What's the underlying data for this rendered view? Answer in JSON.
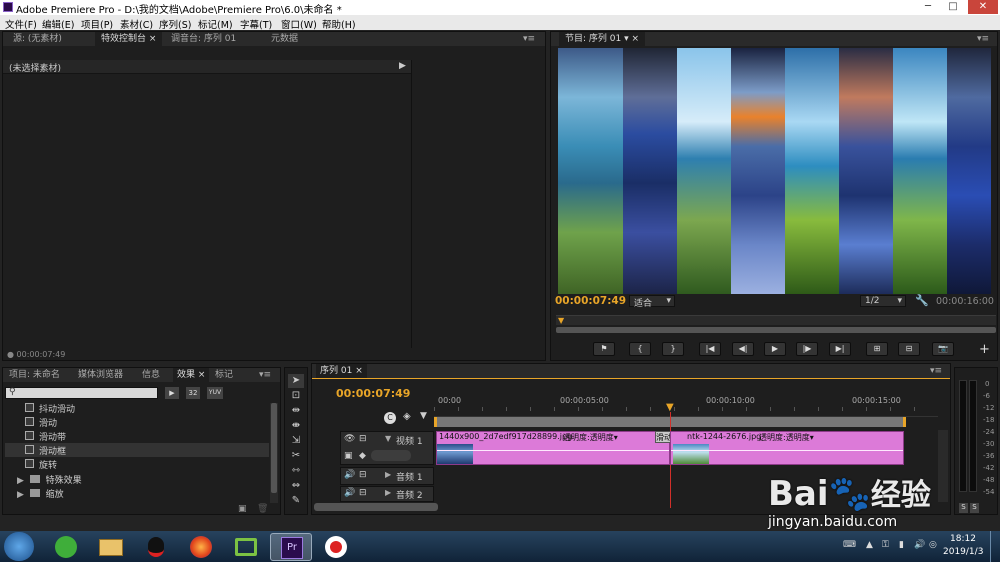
{
  "window": {
    "title": "Adobe Premiere Pro - D:\\我的文档\\Adobe\\Premiere Pro\\6.0\\未命名 *",
    "min": "─",
    "max": "□",
    "close": "✕"
  },
  "menu": [
    "文件(F)",
    "编辑(E)",
    "项目(P)",
    "素材(C)",
    "序列(S)",
    "标记(M)",
    "字幕(T)",
    "窗口(W)",
    "帮助(H)"
  ],
  "source_panel": {
    "tabs": [
      "源: (无素材)",
      "特效控制台",
      "调音台: 序列 01",
      "元数据"
    ],
    "no_clip": "(未选择素材)",
    "timecode": "00:00:07:49"
  },
  "program_panel": {
    "tab": "节目: 序列 01",
    "timecode": "00:00:07:49",
    "fit": "适合",
    "resolution": "1/2",
    "duration": "00:00:16:00",
    "buttons": [
      "⚑",
      "{",
      "}",
      "|◀",
      "◀|",
      "▶",
      "|▶",
      "▶|",
      "⊞",
      "⊟",
      "📷"
    ],
    "add": "+"
  },
  "project_panel": {
    "tabs": [
      "项目: 未命名",
      "媒体浏览器",
      "信息",
      "效果",
      "标记"
    ],
    "badges": [
      "▶",
      "32",
      "YUV"
    ],
    "effects": [
      "抖动滑动",
      "滑动",
      "滑动带",
      "滑动框",
      "旋转"
    ],
    "folders": [
      "特殊效果",
      "缩放"
    ]
  },
  "timeline": {
    "tab": "序列 01",
    "timecode": "00:00:07:49",
    "ruler": [
      "00:00",
      "00:00:05:00",
      "00:00:10:00",
      "00:00:15:00"
    ],
    "tracks": {
      "video1": "视频 1",
      "audio1": "音频 1",
      "audio2": "音频 2"
    },
    "clip1": {
      "name": "1440x900_2d7edf917d28899.jpg",
      "fx": "透明度:透明度▾"
    },
    "transition": "滑动框",
    "clip2": {
      "name": "ntk-1244-2676.jpg",
      "fx": "透明度:透明度▾"
    },
    "meter_labels": [
      "0",
      "-6",
      "-12",
      "-18",
      "-24",
      "-30",
      "-36",
      "-42",
      "-48",
      "-54"
    ],
    "meter_s": [
      "S",
      "S"
    ]
  },
  "taskbar": {
    "time": "18:12",
    "date": "2019/1/3"
  },
  "watermark": {
    "brand": "Bai",
    "cn": "经验",
    "url": "jingyan.baidu.com"
  },
  "colors": {
    "accent": "#e8a528",
    "clip": "#dc7ad8",
    "panel": "#1e1e1e"
  }
}
